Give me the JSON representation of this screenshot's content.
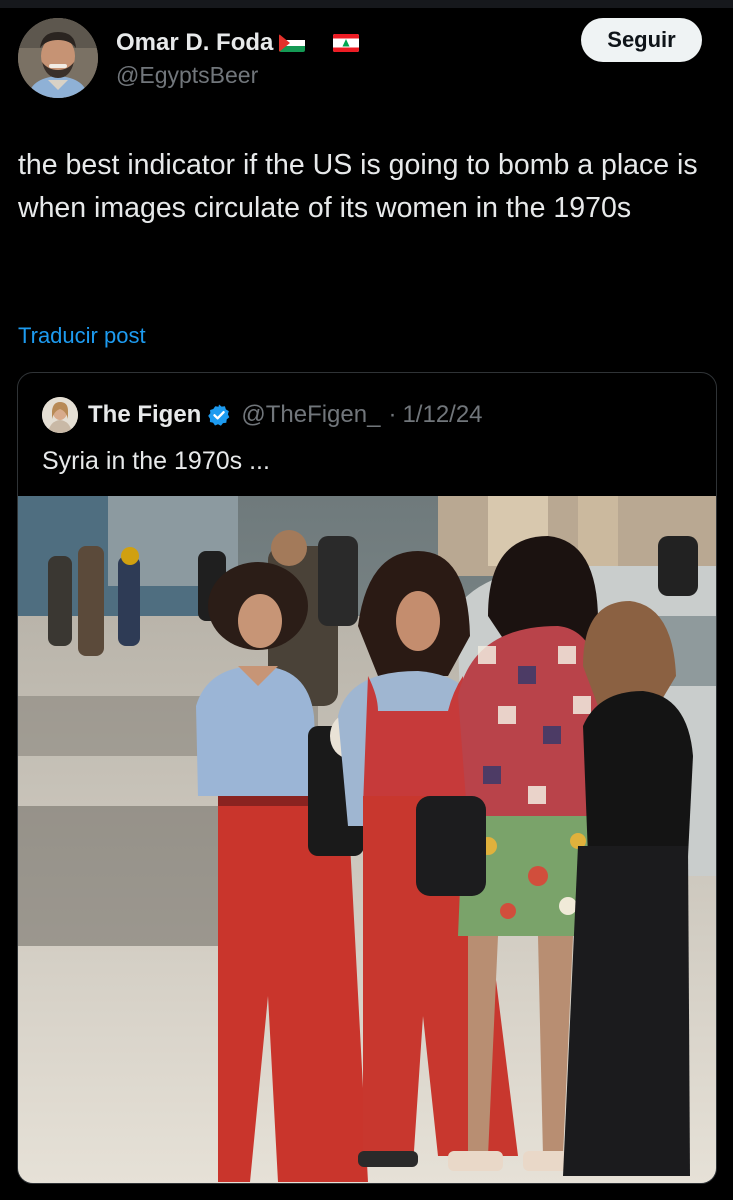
{
  "author": {
    "display_name": "Omar D. Foda",
    "handle": "@EgyptsBeer",
    "flags": [
      "palestine-flag-icon",
      "lebanon-flag-icon"
    ],
    "follow_label": "Seguir"
  },
  "tweet": {
    "text": "the best indicator if the US is going to bomb a place is when images circulate of its women in the 1970s",
    "translate_label": "Traducir post"
  },
  "quoted": {
    "display_name": "The Figen",
    "verified": true,
    "handle": "@TheFigen_",
    "separator": "·",
    "date": "1/12/24",
    "text": "Syria in the 1970s ...",
    "photo_subject": "street-photo-women-1970s"
  },
  "colors": {
    "background": "#000000",
    "primary_text": "#e7e9ea",
    "secondary_text": "#71767b",
    "link": "#1d9bf0",
    "verified_badge": "#1d9bf0",
    "follow_button_bg": "#eff3f4",
    "card_border": "#2f3336"
  }
}
